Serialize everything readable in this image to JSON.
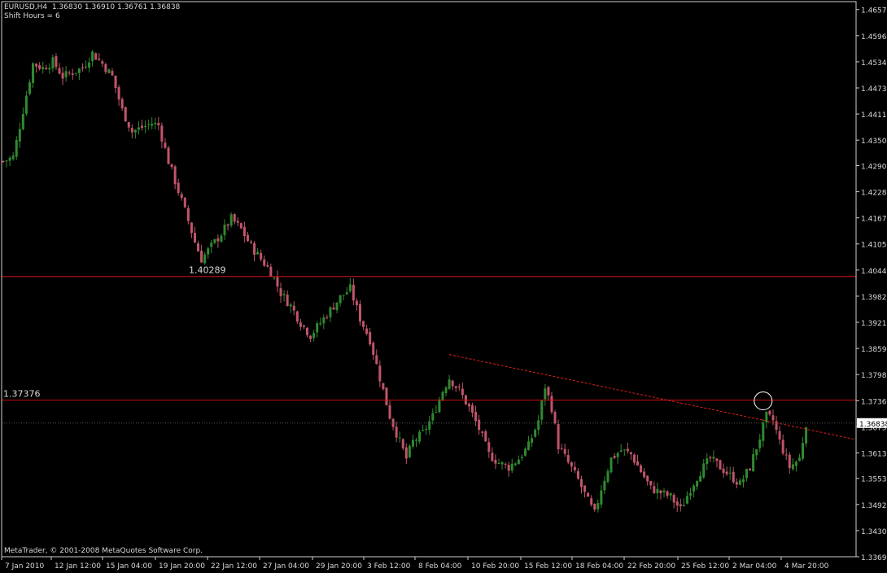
{
  "header": {
    "symbol_line": "EURUSD,H4  1.36830 1.36910 1.36761 1.36838",
    "indicator_line": "Shift Hours = 6"
  },
  "footer": {
    "copyright": "MetaTrader, © 2001-2008 MetaQuotes Software Corp."
  },
  "colors": {
    "background": "#000000",
    "bull_candle": "#2f8a2f",
    "bear_candle": "#c0556a",
    "level_line": "#d01010",
    "trend_line": "#e02020",
    "axis": "#cfcfcf",
    "text": "#d8d8d8"
  },
  "chart_data": {
    "type": "candlestick",
    "symbol": "EURUSD",
    "timeframe": "H4",
    "ylim": [
      1.3369,
      1.4657
    ],
    "y_ticks": [
      "1.46575",
      "1.45960",
      "1.45345",
      "1.44730",
      "1.44115",
      "1.43500",
      "1.42900",
      "1.42285",
      "1.41670",
      "1.41055",
      "1.40440",
      "1.39825",
      "1.39210",
      "1.38595",
      "1.37980",
      "1.37365",
      "1.36750",
      "1.36135",
      "1.35535",
      "1.34920",
      "1.34305",
      "1.33690"
    ],
    "x_ticks": [
      "7 Jan 2010",
      "12 Jan 12:00",
      "15 Jan 04:00",
      "19 Jan 20:00",
      "22 Jan 12:00",
      "27 Jan 04:00",
      "29 Jan 20:00",
      "3 Feb 12:00",
      "8 Feb 04:00",
      "10 Feb 20:00",
      "15 Feb 12:00",
      "18 Feb 04:00",
      "22 Feb 20:00",
      "25 Feb 12:00",
      "2 Mar 04:00",
      "4 Mar 20:00"
    ],
    "close_path": [
      [
        0,
        1.43
      ],
      [
        3,
        1.431
      ],
      [
        6,
        1.442
      ],
      [
        9,
        1.453
      ],
      [
        12,
        1.452
      ],
      [
        15,
        1.4535
      ],
      [
        18,
        1.45
      ],
      [
        21,
        1.451
      ],
      [
        24,
        1.452
      ],
      [
        27,
        1.4555
      ],
      [
        30,
        1.453
      ],
      [
        33,
        1.45
      ],
      [
        36,
        1.442
      ],
      [
        39,
        1.437
      ],
      [
        42,
        1.438
      ],
      [
        45,
        1.439
      ],
      [
        47,
        1.4385
      ],
      [
        50,
        1.43
      ],
      [
        53,
        1.423
      ],
      [
        56,
        1.416
      ],
      [
        58,
        1.411
      ],
      [
        60,
        1.407
      ],
      [
        63,
        1.41
      ],
      [
        66,
        1.413
      ],
      [
        69,
        1.4165
      ],
      [
        72,
        1.414
      ],
      [
        75,
        1.41
      ],
      [
        78,
        1.407
      ],
      [
        81,
        1.404
      ],
      [
        84,
        1.399
      ],
      [
        87,
        1.396
      ],
      [
        90,
        1.392
      ],
      [
        93,
        1.389
      ],
      [
        96,
        1.392
      ],
      [
        99,
        1.395
      ],
      [
        102,
        1.398
      ],
      [
        105,
        1.4
      ],
      [
        108,
        1.393
      ],
      [
        111,
        1.388
      ],
      [
        114,
        1.379
      ],
      [
        117,
        1.37
      ],
      [
        120,
        1.364
      ],
      [
        122,
        1.36
      ],
      [
        124,
        1.364
      ],
      [
        127,
        1.366
      ],
      [
        130,
        1.37
      ],
      [
        133,
        1.376
      ],
      [
        135,
        1.379
      ],
      [
        138,
        1.376
      ],
      [
        141,
        1.372
      ],
      [
        144,
        1.367
      ],
      [
        147,
        1.361
      ],
      [
        150,
        1.359
      ],
      [
        153,
        1.358
      ],
      [
        156,
        1.36
      ],
      [
        159,
        1.363
      ],
      [
        162,
        1.369
      ],
      [
        164,
        1.377
      ],
      [
        166,
        1.372
      ],
      [
        168,
        1.363
      ],
      [
        171,
        1.359
      ],
      [
        174,
        1.355
      ],
      [
        177,
        1.35
      ],
      [
        179,
        1.347
      ],
      [
        181,
        1.353
      ],
      [
        184,
        1.36
      ],
      [
        187,
        1.362
      ],
      [
        190,
        1.361
      ],
      [
        193,
        1.357
      ],
      [
        196,
        1.353
      ],
      [
        199,
        1.352
      ],
      [
        202,
        1.351
      ],
      [
        205,
        1.348
      ],
      [
        208,
        1.353
      ],
      [
        211,
        1.357
      ],
      [
        214,
        1.36
      ],
      [
        217,
        1.358
      ],
      [
        220,
        1.356
      ],
      [
        223,
        1.354
      ],
      [
        226,
        1.358
      ],
      [
        229,
        1.365
      ],
      [
        231,
        1.37
      ],
      [
        233,
        1.369
      ],
      [
        235,
        1.364
      ],
      [
        238,
        1.358
      ],
      [
        241,
        1.36
      ],
      [
        243,
        1.3684
      ]
    ],
    "horizontal_levels": [
      {
        "value": 1.40289,
        "label": "1.40289"
      },
      {
        "value": 1.37376,
        "label": "1.37376"
      }
    ],
    "trend_line": {
      "from": [
        135,
        1.3845
      ],
      "to": [
        258,
        1.3645
      ],
      "style": "dashed"
    },
    "current_price": "1.36838",
    "marker_circle": {
      "bar": 230,
      "price": 1.3736
    }
  }
}
